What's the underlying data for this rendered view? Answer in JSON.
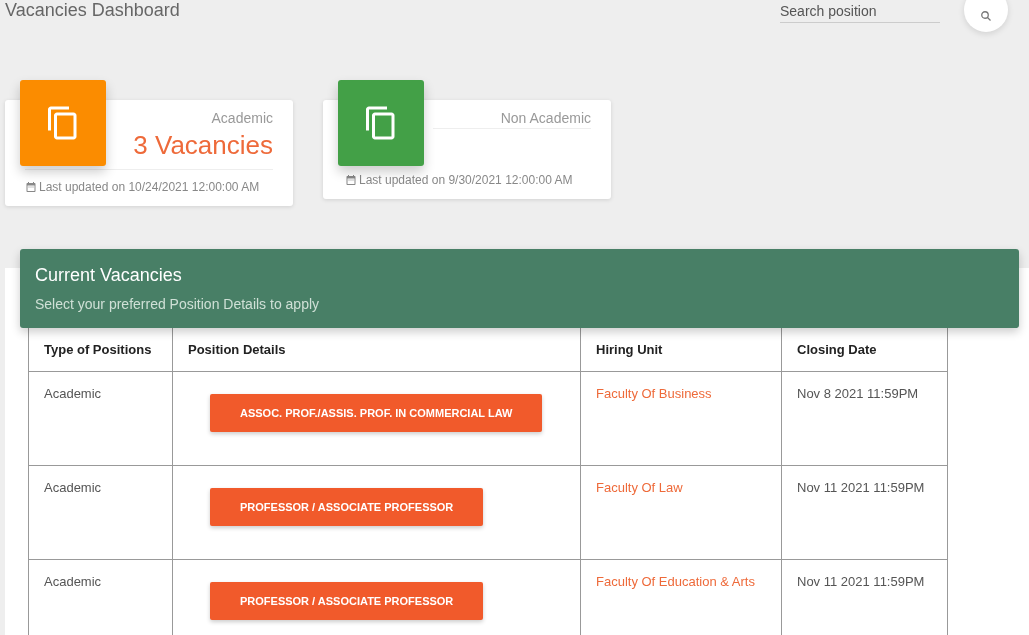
{
  "header": {
    "title": "Vacancies Dashboard",
    "search": {
      "placeholder": "Search position"
    }
  },
  "cards": [
    {
      "category": "Academic",
      "color": "#fb8c00",
      "count": "3 Vacancies",
      "updated": "Last updated on 10/24/2021 12:00:00 AM"
    },
    {
      "category": "Non Academic",
      "color": "#43a047",
      "updated": "Last updated on 9/30/2021 12:00:00 AM"
    }
  ],
  "panel": {
    "title": "Current Vacancies",
    "subtitle": "Select your preferred Position Details to apply"
  },
  "table": {
    "columns": [
      "Type of Positions",
      "Position Details",
      "Hiring Unit",
      "Closing Date"
    ],
    "rows": [
      {
        "type": "Academic",
        "position": "ASSOC. PROF./ASSIS. PROF. IN COMMERCIAL LAW",
        "unit": "Faculty Of Business",
        "closing": "Nov 8 2021 11:59PM"
      },
      {
        "type": "Academic",
        "position": "PROFESSOR / ASSOCIATE PROFESSOR",
        "unit": "Faculty Of Law",
        "closing": "Nov 11 2021 11:59PM"
      },
      {
        "type": "Academic",
        "position": "PROFESSOR / ASSOCIATE PROFESSOR",
        "unit": "Faculty Of Education & Arts",
        "closing": "Nov 11 2021 11:59PM"
      }
    ]
  }
}
